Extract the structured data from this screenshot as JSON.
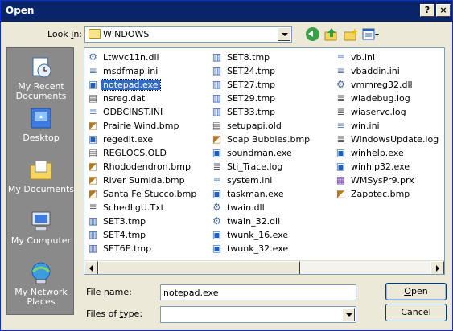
{
  "window": {
    "title": "Open",
    "help_glyph": "?",
    "close_glyph": "×"
  },
  "lookin": {
    "label_prefix": "Look ",
    "label_accel": "i",
    "label_suffix": "n:",
    "value": "WINDOWS"
  },
  "places": [
    {
      "label": "My Recent Documents",
      "icon": "recent-documents-icon"
    },
    {
      "label": "Desktop",
      "icon": "desktop-icon"
    },
    {
      "label": "My Documents",
      "icon": "my-documents-icon"
    },
    {
      "label": "My Computer",
      "icon": "my-computer-icon"
    },
    {
      "label": "My Network Places",
      "icon": "network-places-icon"
    }
  ],
  "files": {
    "col1": [
      {
        "name": "Ltwvc11n.dll",
        "type": "dll"
      },
      {
        "name": "msdfmap.ini",
        "type": "ini"
      },
      {
        "name": "notepad.exe",
        "type": "exe",
        "selected": true
      },
      {
        "name": "nsreg.dat",
        "type": "dat"
      },
      {
        "name": "ODBCINST.INI",
        "type": "ini"
      },
      {
        "name": "Prairie Wind.bmp",
        "type": "bmp"
      },
      {
        "name": "regedit.exe",
        "type": "exe"
      },
      {
        "name": "REGLOCS.OLD",
        "type": "old"
      },
      {
        "name": "Rhododendron.bmp",
        "type": "bmp"
      },
      {
        "name": "River Sumida.bmp",
        "type": "bmp"
      },
      {
        "name": "Santa Fe Stucco.bmp",
        "type": "bmp"
      },
      {
        "name": "SchedLgU.Txt",
        "type": "txt"
      },
      {
        "name": "SET3.tmp",
        "type": "tmp"
      },
      {
        "name": "SET4.tmp",
        "type": "tmp"
      },
      {
        "name": "SET6E.tmp",
        "type": "tmp"
      }
    ],
    "col2": [
      {
        "name": "SET8.tmp",
        "type": "tmp"
      },
      {
        "name": "SET24.tmp",
        "type": "tmp"
      },
      {
        "name": "SET27.tmp",
        "type": "tmp"
      },
      {
        "name": "SET29.tmp",
        "type": "tmp"
      },
      {
        "name": "SET33.tmp",
        "type": "tmp"
      },
      {
        "name": "setupapi.old",
        "type": "old"
      },
      {
        "name": "Soap Bubbles.bmp",
        "type": "bmp"
      },
      {
        "name": "soundman.exe",
        "type": "exe"
      },
      {
        "name": "Sti_Trace.log",
        "type": "log"
      },
      {
        "name": "system.ini",
        "type": "ini"
      },
      {
        "name": "taskman.exe",
        "type": "exe"
      },
      {
        "name": "twain.dll",
        "type": "dll"
      },
      {
        "name": "twain_32.dll",
        "type": "dll"
      },
      {
        "name": "twunk_16.exe",
        "type": "exe"
      },
      {
        "name": "twunk_32.exe",
        "type": "exe"
      }
    ],
    "col3": [
      {
        "name": "vb.ini",
        "type": "ini"
      },
      {
        "name": "vbaddin.ini",
        "type": "ini"
      },
      {
        "name": "vmmreg32.dll",
        "type": "dll"
      },
      {
        "name": "wiadebug.log",
        "type": "log"
      },
      {
        "name": "wiaservc.log",
        "type": "log"
      },
      {
        "name": "win.ini",
        "type": "ini"
      },
      {
        "name": "WindowsUpdate.log",
        "type": "log"
      },
      {
        "name": "winhelp.exe",
        "type": "exe"
      },
      {
        "name": "winhlp32.exe",
        "type": "exe"
      },
      {
        "name": "WMSysPr9.prx",
        "type": "prx"
      },
      {
        "name": "Zapotec.bmp",
        "type": "bmp"
      }
    ]
  },
  "filename": {
    "label_prefix": "File ",
    "label_accel": "n",
    "label_suffix": "ame:",
    "value": "notepad.exe"
  },
  "filetype": {
    "label_prefix": "Files of ",
    "label_accel": "t",
    "label_suffix": "ype:",
    "value": ""
  },
  "buttons": {
    "open_accel": "O",
    "open_rest": "pen",
    "cancel": "Cancel"
  }
}
